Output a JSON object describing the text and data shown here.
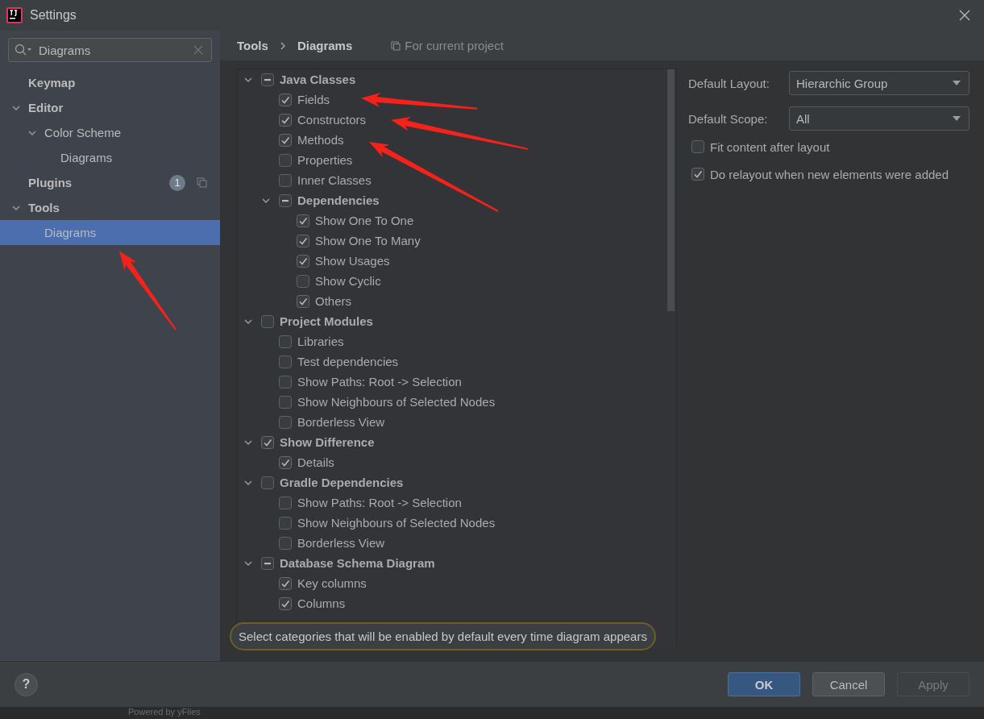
{
  "window": {
    "title": "Settings"
  },
  "sidebar": {
    "search": {
      "value": "Diagrams"
    },
    "items": [
      {
        "label": "Keymap",
        "selected": false
      },
      {
        "label": "Editor",
        "expanded": true,
        "selected": false,
        "children": [
          {
            "label": "Color Scheme",
            "expanded": true,
            "selected": false,
            "children": [
              {
                "label": "Diagrams",
                "selected": false
              }
            ]
          }
        ]
      },
      {
        "label": "Plugins",
        "badge": "1",
        "selected": false
      },
      {
        "label": "Tools",
        "expanded": true,
        "selected": false,
        "children": [
          {
            "label": "Diagrams",
            "selected": true
          }
        ]
      }
    ]
  },
  "breadcrumb": [
    "Tools",
    "Diagrams"
  ],
  "scope_note": "For current project",
  "categories": [
    {
      "label": "Java Classes",
      "mixed": true,
      "expanded": true,
      "children": [
        {
          "label": "Fields",
          "checked": true,
          "mixed": false
        },
        {
          "label": "Constructors",
          "checked": true,
          "mixed": false
        },
        {
          "label": "Methods",
          "checked": true,
          "mixed": false
        },
        {
          "label": "Properties",
          "checked": false,
          "mixed": false
        },
        {
          "label": "Inner Classes",
          "checked": false,
          "mixed": false
        },
        {
          "label": "Dependencies",
          "mixed": true,
          "expanded": true,
          "children": [
            {
              "label": "Show One To One",
              "checked": true,
              "mixed": false
            },
            {
              "label": "Show One To Many",
              "checked": true,
              "mixed": false
            },
            {
              "label": "Show Usages",
              "checked": true,
              "mixed": false
            },
            {
              "label": "Show Cyclic",
              "checked": false,
              "mixed": false
            },
            {
              "label": "Others",
              "checked": true,
              "mixed": false
            }
          ]
        }
      ]
    },
    {
      "label": "Project Modules",
      "checked": false,
      "mixed": false,
      "expanded": true,
      "children": [
        {
          "label": "Libraries",
          "checked": false,
          "mixed": false
        },
        {
          "label": "Test dependencies",
          "checked": false,
          "mixed": false
        },
        {
          "label": "Show Paths: Root -> Selection",
          "checked": false,
          "mixed": false
        },
        {
          "label": "Show Neighbours of Selected Nodes",
          "checked": false,
          "mixed": false
        },
        {
          "label": "Borderless View",
          "checked": false,
          "mixed": false
        }
      ]
    },
    {
      "label": "Show Difference",
      "checked": true,
      "mixed": false,
      "expanded": true,
      "children": [
        {
          "label": "Details",
          "checked": true,
          "mixed": false
        }
      ]
    },
    {
      "label": "Gradle Dependencies",
      "checked": false,
      "mixed": false,
      "expanded": true,
      "children": [
        {
          "label": "Show Paths: Root -> Selection",
          "checked": false,
          "mixed": false
        },
        {
          "label": "Show Neighbours of Selected Nodes",
          "checked": false,
          "mixed": false
        },
        {
          "label": "Borderless View",
          "checked": false,
          "mixed": false
        }
      ]
    },
    {
      "label": "Database Schema Diagram",
      "mixed": true,
      "expanded": true,
      "children": [
        {
          "label": "Key columns",
          "checked": true,
          "mixed": false
        },
        {
          "label": "Columns",
          "checked": true,
          "mixed": false
        }
      ]
    }
  ],
  "settings": {
    "fields": [
      {
        "label": "Default Layout:",
        "value": "Hierarchic Group"
      },
      {
        "label": "Default Scope:",
        "value": "All"
      }
    ],
    "options": [
      {
        "label": "Fit content after layout",
        "checked": false
      },
      {
        "label": "Do relayout when new elements were added",
        "checked": true
      }
    ]
  },
  "hint": "Select categories that will be enabled by default every time diagram appears",
  "help": "?",
  "buttons": [
    {
      "label": "OK",
      "default": true,
      "disabled": false
    },
    {
      "label": "Cancel",
      "default": false,
      "disabled": false
    },
    {
      "label": "Apply",
      "default": false,
      "disabled": true
    }
  ],
  "footer": "Powered by yFiles"
}
